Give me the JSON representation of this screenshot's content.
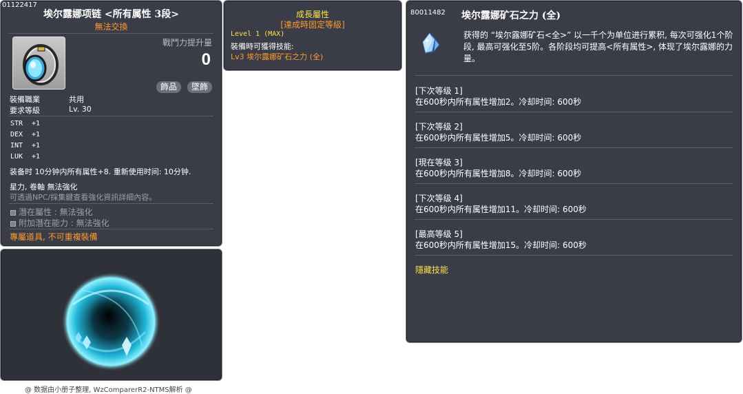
{
  "item": {
    "id": "01122417",
    "title": "埃尔露娜项链 <所有属性 3段>",
    "trade": "無法交換",
    "power_label": "戰鬥力提升量",
    "power_value": "0",
    "tags": [
      "飾品",
      "墜飾"
    ],
    "job_label": "裝備職業",
    "job_value": "共用",
    "level_label": "要求等級",
    "level_value": "Lv. 30",
    "stats": [
      {
        "name": "STR",
        "value": "+1"
      },
      {
        "name": "DEX",
        "value": "+1"
      },
      {
        "name": "INT",
        "value": "+1"
      },
      {
        "name": "LUK",
        "value": "+1"
      }
    ],
    "desc1": "装备时 10分钟内所有属性+8. 重新使用时间: 10分钟.",
    "desc2": "星力, 卷軸 無法強化",
    "hint": "可透過NPC/採集鍵查看強化資訊詳細內容。",
    "potential": "潛在屬性 : 無法強化",
    "bonus_potential": "附加潛在能力 : 無法強化",
    "unique": "專屬道具, 不可重複裝備"
  },
  "growth": {
    "title": "成長屬性",
    "subtitle": "[達成時固定等級]",
    "level_line": "Level 1 (MAX)",
    "skill_label": "裝備時可獲得技能:",
    "skill_value": "Lv3 埃尔露娜矿石之力 (全)"
  },
  "skill": {
    "id": "80011482",
    "name": "埃尔露娜矿石之力 (全)",
    "description": "获得的 “埃尔露娜矿石<全>” 以一千个为单位进行累积, 每次可强化1个阶段, 最高可强化至5阶。各阶段均可提高<所有属性>, 体现了埃尔露娜的力量。",
    "levels": [
      {
        "head": "[下次等级 1]",
        "body": "在600秒内所有属性增加2。冷却时间: 600秒"
      },
      {
        "head": "[下次等级 2]",
        "body": "在600秒内所有属性增加5。冷却时间: 600秒"
      },
      {
        "head": "[現在等级 3]",
        "body": "在600秒内所有属性增加8。冷却时间: 600秒"
      },
      {
        "head": "[下次等级 4]",
        "body": "在600秒内所有属性增加11。冷却时间: 600秒"
      },
      {
        "head": "[最高等级 5]",
        "body": "在600秒内所有属性增加15。冷却时间: 600秒"
      }
    ],
    "hidden_label": "隱藏技能"
  },
  "footer": "@ 数据由小册子整理, WzComparerR2-NTMS解析 @",
  "icons": {
    "item_icon": "pendant-icon",
    "skill_icon": "crystal-icon",
    "potential_icon": "square-bullet-icon"
  },
  "colors": {
    "panel_bg": "#3a3d47",
    "orange": "#ff9a2e",
    "yellow": "#ffe04a",
    "muted": "#9ea0a8"
  }
}
